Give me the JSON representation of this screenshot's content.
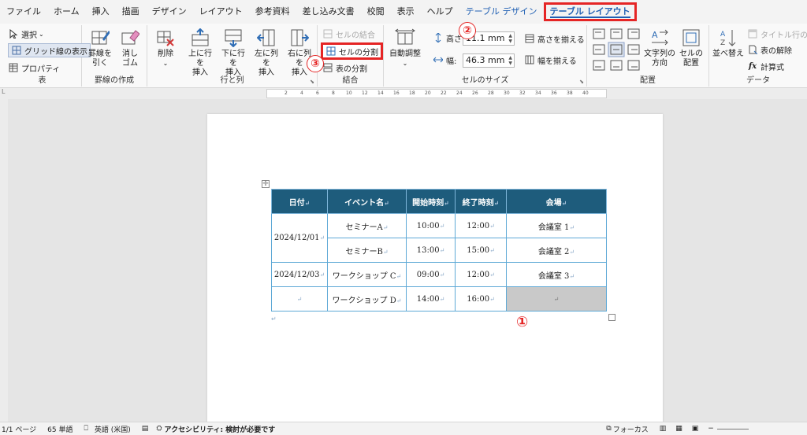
{
  "menu": {
    "tabs": [
      "ファイル",
      "ホーム",
      "挿入",
      "描画",
      "デザイン",
      "レイアウト",
      "参考資料",
      "差し込み文書",
      "校閲",
      "表示",
      "ヘルプ",
      "テーブル デザイン",
      "テーブル レイアウト"
    ]
  },
  "ribbon": {
    "table_group": {
      "select": "選択",
      "gridlines": "グリッド線の表示",
      "properties": "プロパティ",
      "label": "表"
    },
    "draw_group": {
      "draw": [
        "罫線を",
        "引く"
      ],
      "erase": [
        "消し",
        "ゴム"
      ],
      "label": "罫線の作成"
    },
    "rows_cols_group": {
      "delete": "削除",
      "insert_above": [
        "上に行を",
        "挿入"
      ],
      "insert_below": [
        "下に行を",
        "挿入"
      ],
      "insert_left": [
        "左に列を",
        "挿入"
      ],
      "insert_right": [
        "右に列を",
        "挿入"
      ],
      "label": "行と列"
    },
    "merge_group": {
      "merge": "セルの結合",
      "split_cells": "セルの分割",
      "split_table": "表の分割",
      "label": "結合"
    },
    "size_group": {
      "autofit": "自動調整",
      "height_label": "高さ:",
      "height_value": "11.1 mm",
      "width_label": "幅:",
      "width_value": "46.3 mm",
      "distribute_rows": "高さを揃える",
      "distribute_cols": "幅を揃える",
      "label": "セルのサイズ"
    },
    "align_group": {
      "text_direction": [
        "文字列の",
        "方向"
      ],
      "cell_margins": [
        "セルの",
        "配置"
      ],
      "label": "配置"
    },
    "data_group": {
      "sort": "並べ替え",
      "repeat_header": "タイトル行の繰り",
      "convert": "表の解除",
      "formula": "計算式",
      "label": "データ"
    }
  },
  "ruler": {
    "ticks": [
      "2",
      "4",
      "6",
      "8",
      "10",
      "12",
      "14",
      "16",
      "18",
      "20",
      "22",
      "24",
      "26",
      "28",
      "30",
      "32",
      "34",
      "36",
      "38",
      "40"
    ]
  },
  "table": {
    "headers": [
      "日付",
      "イベント名",
      "開始時刻",
      "終了時刻",
      "会場"
    ],
    "rows": [
      {
        "date": "2024/12/01",
        "event": "セミナーA",
        "start": "10:00",
        "end": "12:00",
        "venue": "会議室 1"
      },
      {
        "date": "",
        "event": "セミナーB",
        "start": "13:00",
        "end": "15:00",
        "venue": "会議室 2"
      },
      {
        "date": "2024/12/03",
        "event": "ワークショップ C",
        "start": "09:00",
        "end": "12:00",
        "venue": "会議室 3"
      },
      {
        "date": "",
        "event": "ワークショップ D",
        "start": "14:00",
        "end": "16:00",
        "venue": ""
      }
    ],
    "paragraph_mark": "↵",
    "end_mark": "↵"
  },
  "callouts": {
    "one": "①",
    "two": "②",
    "three": "③"
  },
  "status": {
    "page": "1/1 ページ",
    "words": "65 単語",
    "language": "英語 (米国)",
    "accessibility": "アクセシビリティ: 検討が必要です",
    "focus": "フォーカス"
  },
  "colors": {
    "accent": "#1f5fb3",
    "highlight": "#e52525",
    "header_fill": "#1e5c7c",
    "shade": "#c9c9c9"
  }
}
